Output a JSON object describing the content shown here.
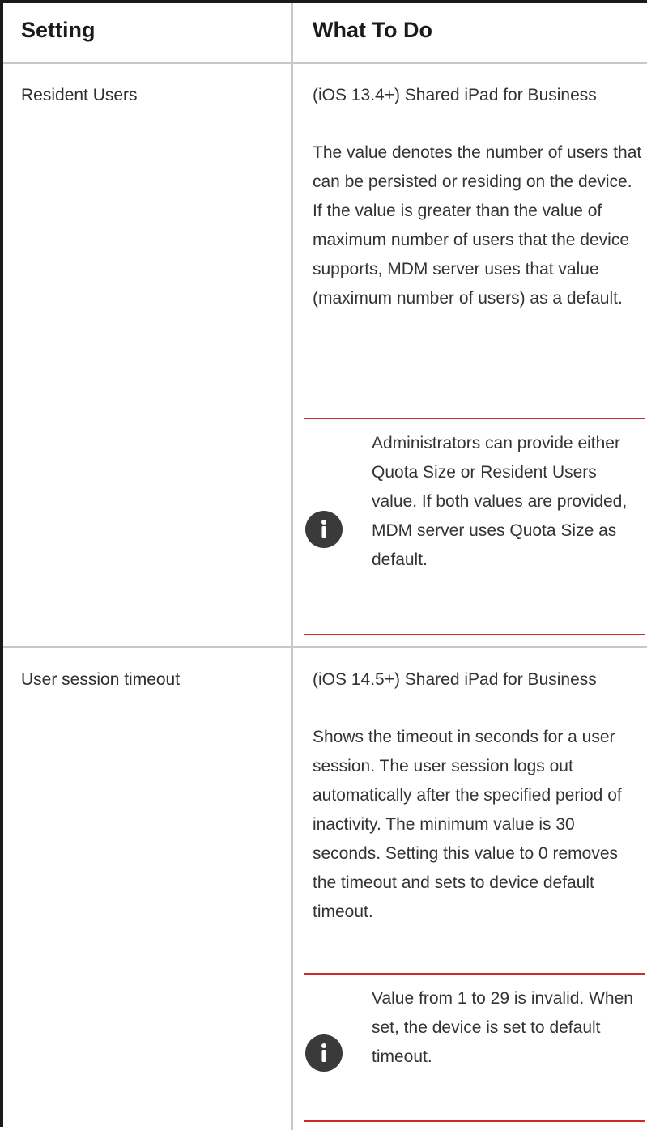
{
  "table": {
    "headers": {
      "setting": "Setting",
      "what_to_do": "What To Do"
    },
    "rows": [
      {
        "setting": "Resident Users",
        "platform": "(iOS 13.4+) Shared iPad for Business",
        "description": "The value denotes the number of users that can be persisted or residing on the device. If the value is greater than the value of maximum number of users that the device supports, MDM server uses that value (maximum number of users) as a default.",
        "note": {
          "icon": "info-icon",
          "text": "Administrators can provide either Quota Size or Resident Users value. If both values are provided, MDM server uses Quota Size as default."
        }
      },
      {
        "setting": "User session timeout",
        "platform": "(iOS 14.5+) Shared iPad for Business",
        "description": "Shows the timeout in seconds for a user session. The user session logs out automatically after the specified period of inactivity. The minimum value is 30 seconds. Setting this value to 0 removes the timeout and sets to device default timeout.",
        "note": {
          "icon": "info-icon",
          "text": "Value from 1 to 29 is invalid. When set, the device is set to default timeout."
        }
      }
    ]
  },
  "colors": {
    "note_rule": "#cf2a2a",
    "note_icon": "#3a3a3a",
    "grid": "#c8c8c8"
  }
}
